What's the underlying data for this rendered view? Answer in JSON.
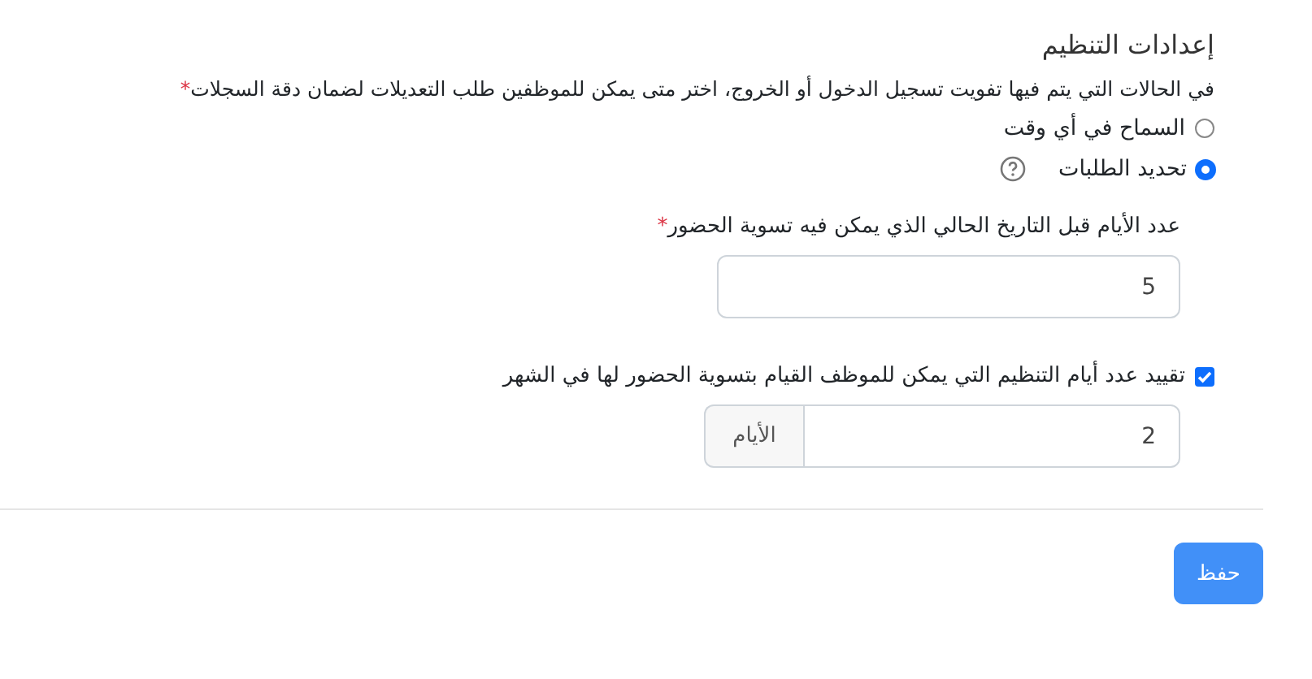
{
  "section": {
    "title": "إعدادات التنظيم",
    "description": "في الحالات التي يتم فيها تفويت تسجيل الدخول أو الخروج، اختر متى يمكن للموظفين طلب التعديلات لضمان دقة السجلات",
    "description_required_mark": "*"
  },
  "options": [
    {
      "label": "السماح في أي وقت",
      "selected": false,
      "help": false
    },
    {
      "label": "تحديد الطلبات",
      "selected": true,
      "help": true
    }
  ],
  "days_field": {
    "label": "عدد الأيام قبل التاريخ الحالي الذي يمكن فيه تسوية الحضور",
    "required_mark": "*",
    "value": "5"
  },
  "limit": {
    "label": "تقييد عدد أيام التنظيم التي يمكن للموظف القيام بتسوية الحضور لها في الشهر",
    "checked": true,
    "value": "2",
    "addon": "الأيام"
  },
  "save_button": "حفظ"
}
